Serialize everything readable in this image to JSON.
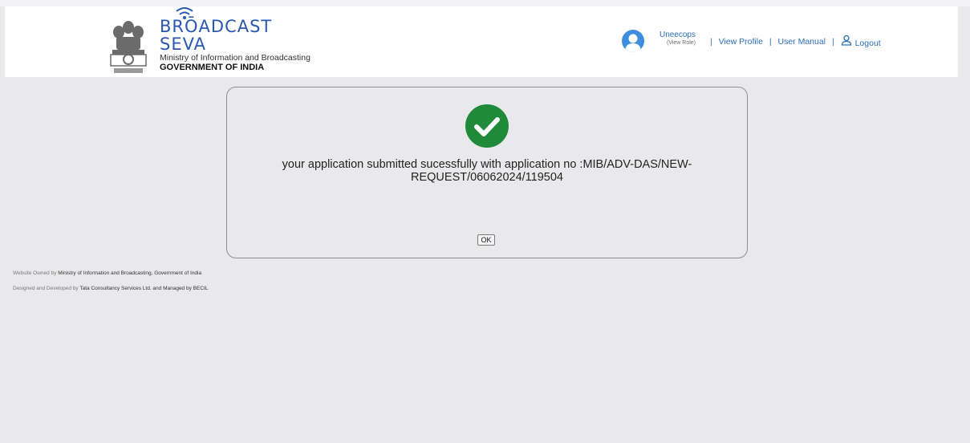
{
  "header": {
    "brand_line1": "BRŌADCAST",
    "brand_line2": "SEVA",
    "ministry": "Ministry of Information and Broadcasting",
    "government": "GOVERNMENT OF INDIA",
    "user": {
      "name": "Uneecops",
      "role_link": "(View Role)"
    },
    "nav": {
      "view_profile": "View Profile",
      "user_manual": "User Manual",
      "logout": "Logout",
      "separator": "|"
    }
  },
  "dialog": {
    "message_line1": "your application submitted sucessfully with application no :MIB/ADV-DAS/NEW-",
    "message_line2": "REQUEST/06062024/119504",
    "ok_label": "OK"
  },
  "footer": {
    "line1_prefix": "Website Owned by",
    "line1_owner": "Ministry of Information and Broadcasting, Government of India",
    "line2_prefix": "Designed and Developed by",
    "line2_developer": "Tata Consultancy Services Ltd. and Managed by BECIL"
  },
  "colors": {
    "brand": "#2a57b0",
    "link": "#2a6db8",
    "success": "#1e8a3a",
    "background": "#e9e9ec"
  },
  "icons": [
    "national-emblem-icon",
    "wifi-signal-icon",
    "user-avatar-icon",
    "user-outline-icon",
    "check-circle-icon"
  ]
}
